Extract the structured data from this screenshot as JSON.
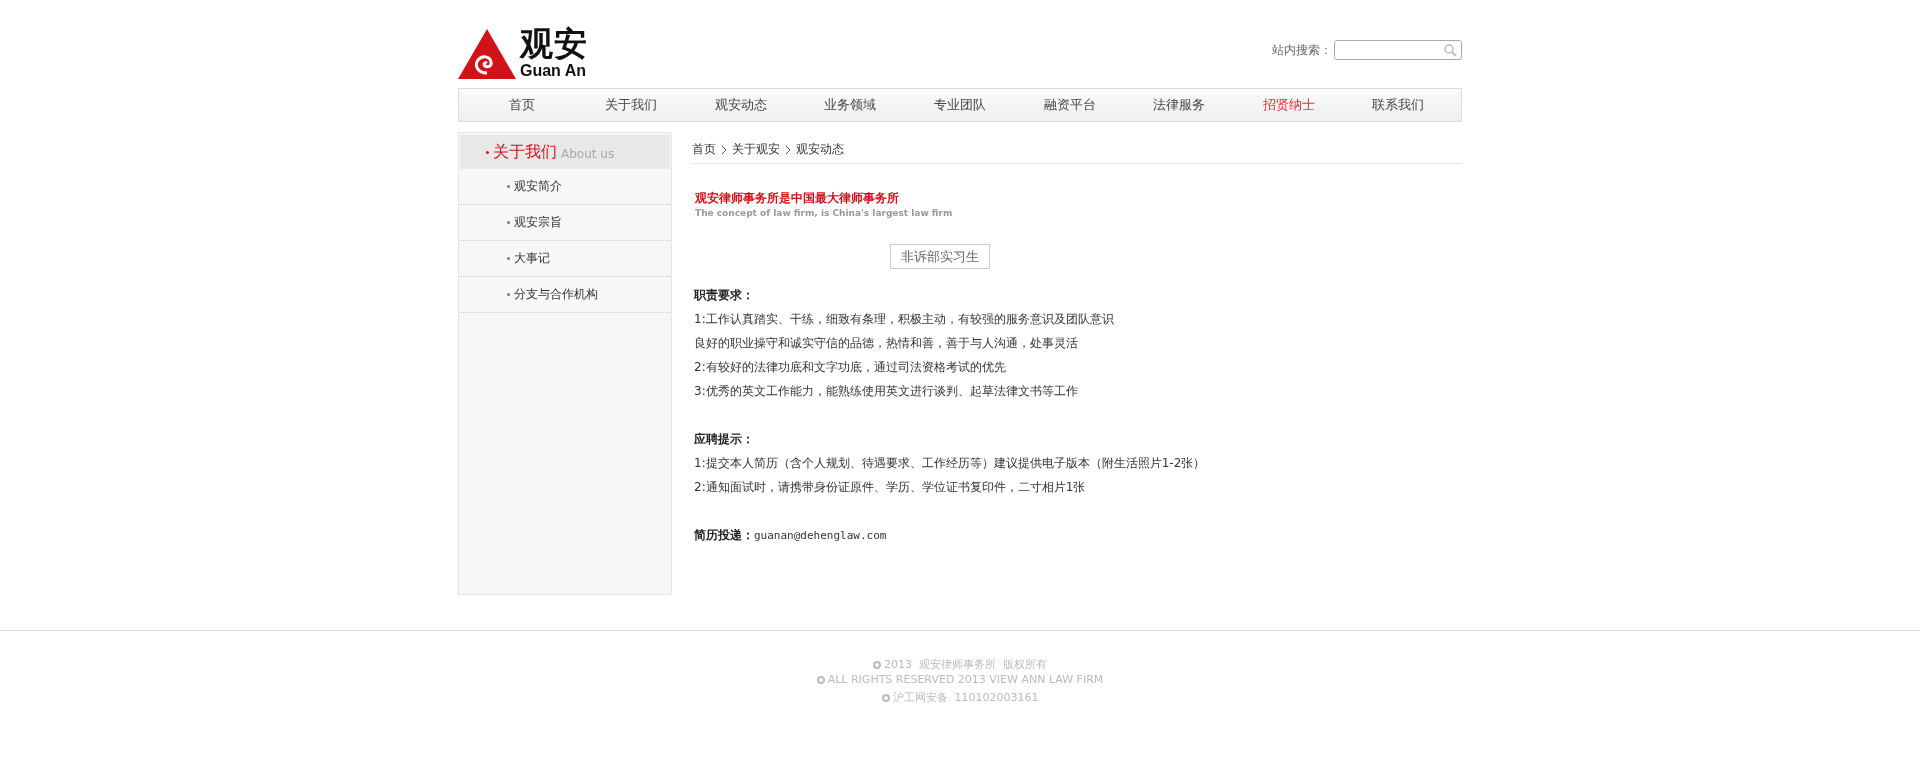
{
  "header": {
    "logo": {
      "name": "观安",
      "latin": "Guan An"
    },
    "search": {
      "label": "站内搜索："
    }
  },
  "nav": [
    {
      "label": "首页",
      "selected": false
    },
    {
      "label": "关于我们",
      "selected": false
    },
    {
      "label": "观安动态",
      "selected": false
    },
    {
      "label": "业务领域",
      "selected": false
    },
    {
      "label": "专业团队",
      "selected": false
    },
    {
      "label": "融资平台",
      "selected": false
    },
    {
      "label": "法律服务",
      "selected": false
    },
    {
      "label": "招贤纳士",
      "selected": true
    },
    {
      "label": "联系我们",
      "selected": false
    }
  ],
  "sidebar": {
    "title": "关于我们",
    "subtitle": "About us",
    "items": [
      {
        "label": "观安简介"
      },
      {
        "label": "观安宗旨"
      },
      {
        "label": "大事记"
      },
      {
        "label": "分支与合作机构"
      }
    ]
  },
  "breadcrumb": [
    "首页",
    "关于观安",
    "观安动态"
  ],
  "banner": {
    "title": "观安律师事务所是中国最大律师事务所",
    "subtitle": "The concept of law firm, is China's largest law firm"
  },
  "position_button": "非诉部实习生",
  "sections": [
    {
      "heading": "职责要求：",
      "lines": [
        "1:工作认真踏实、干练，细致有条理，积极主动，有较强的服务意识及团队意识",
        "良好的职业操守和诚实守信的品德，热情和善，善于与人沟通，处事灵活",
        "2:有较好的法律功底和文字功底，通过司法资格考试的优先",
        "3:优秀的英文工作能力，能熟练使用英文进行谈判、起草法律文书等工作"
      ]
    },
    {
      "heading": "应聘提示：",
      "lines": [
        "1:提交本人简历（含个人规划、待遇要求、工作经历等）建议提供电子版本（附生活照片1-2张）",
        "2:通知面试时，请携带身份证原件、学历、学位证书复印件，二寸相片1张"
      ]
    }
  ],
  "contact": {
    "label": "简历投递：",
    "email": "guanan@dehenglaw.com"
  },
  "footer": {
    "lines": [
      "2013  观安律师事务所  版权所有",
      "ALL RIGHTS RESERVED 2013 VIEW ANN LAW FIRM",
      "沪工网安备  110102003161"
    ]
  }
}
